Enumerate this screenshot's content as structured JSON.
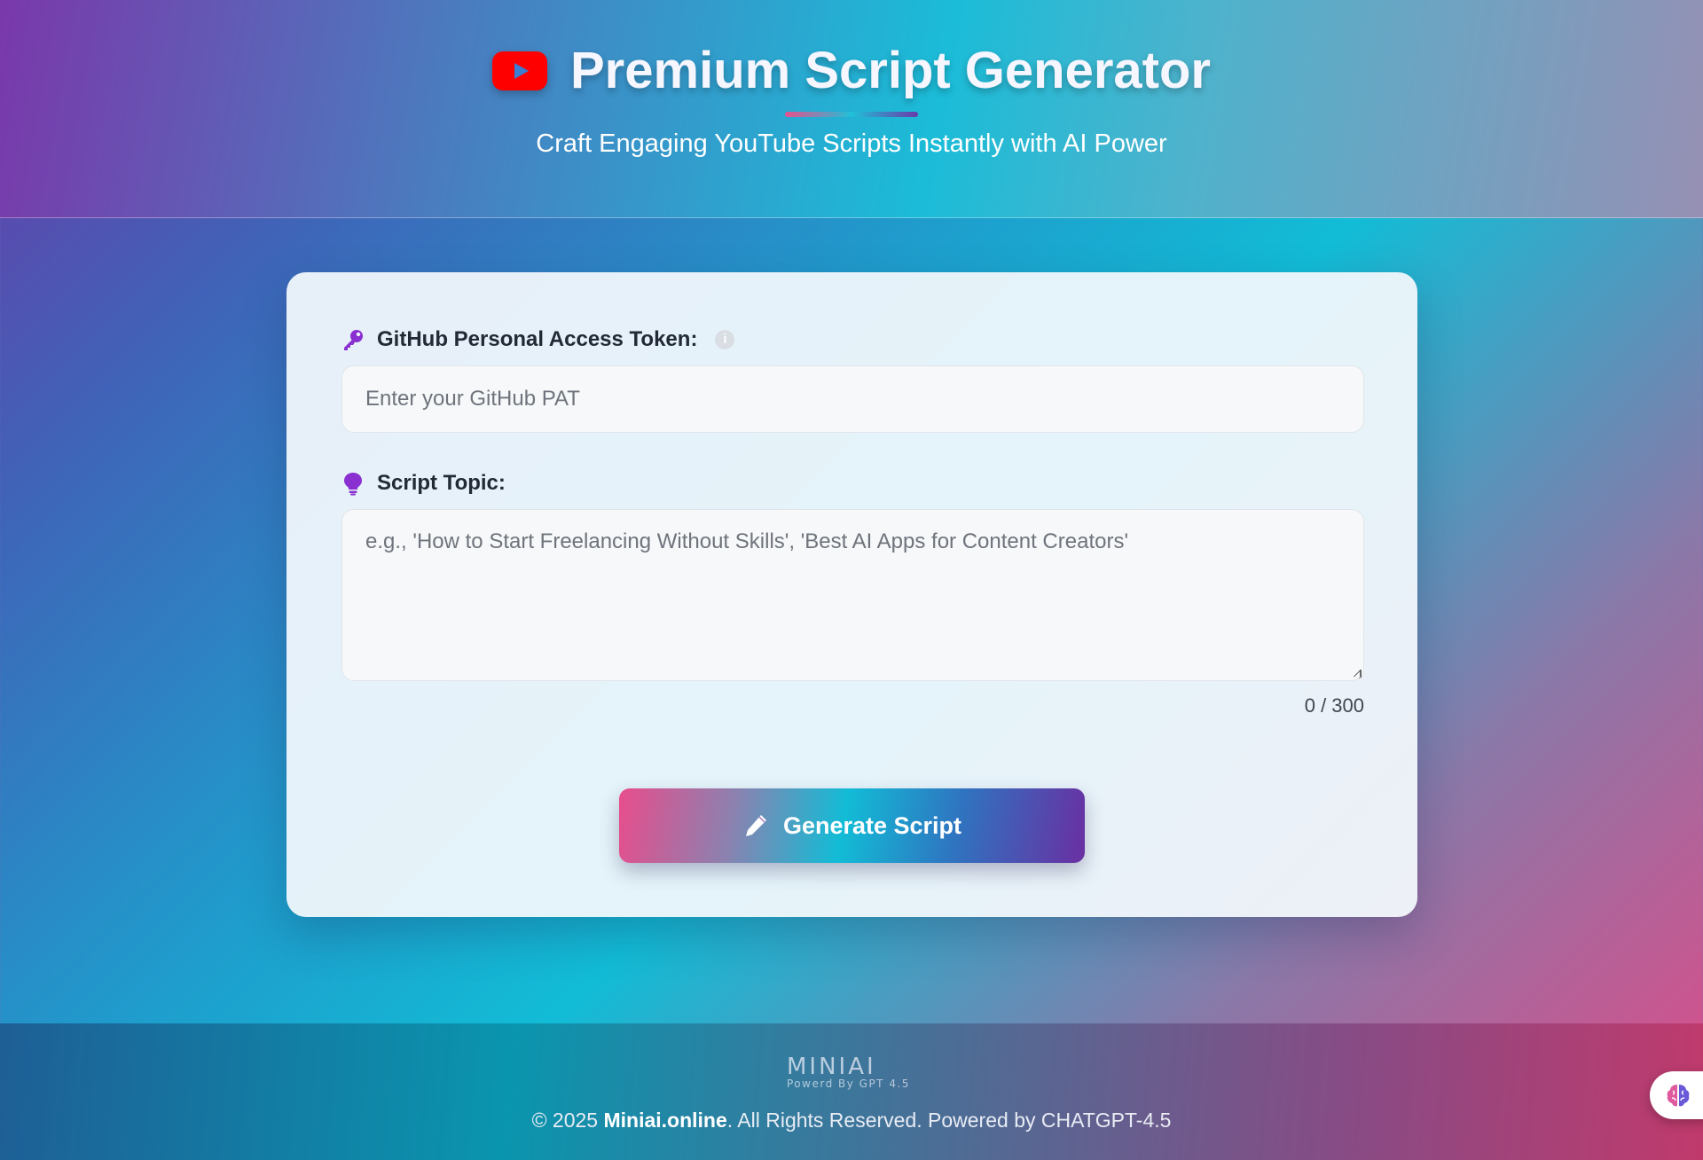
{
  "header": {
    "title": "Premium Script Generator",
    "subtitle": "Craft Engaging YouTube Scripts Instantly with AI Power"
  },
  "form": {
    "token_label": "GitHub Personal Access Token:",
    "token_info_glyph": "i",
    "token_placeholder": "Enter your GitHub PAT",
    "token_value": "",
    "topic_label": "Script Topic:",
    "topic_placeholder": "e.g., 'How to Start Freelancing Without Skills', 'Best AI Apps for Content Creators'",
    "topic_value": "",
    "char_count": "0 / 300",
    "generate_label": "Generate Script"
  },
  "footer": {
    "logo_main": "MINIAI",
    "logo_tagline": "Powerd By GPT 4.5",
    "copyright_prefix": "© 2025 ",
    "brand": "Miniai.online",
    "copyright_suffix": ". All Rights Reserved. Powered by CHATGPT-4.5"
  },
  "icons": {
    "header": "youtube-icon",
    "token": "key-icon",
    "token_info": "info-icon",
    "topic": "lightbulb-icon",
    "generate": "pencil-icon",
    "floating": "brain-icon"
  },
  "colors": {
    "accent_purple": "#8a2fd0",
    "accent_pink": "#e84d8c",
    "accent_cyan": "#12bcd6",
    "youtube_red": "#ff0000"
  }
}
